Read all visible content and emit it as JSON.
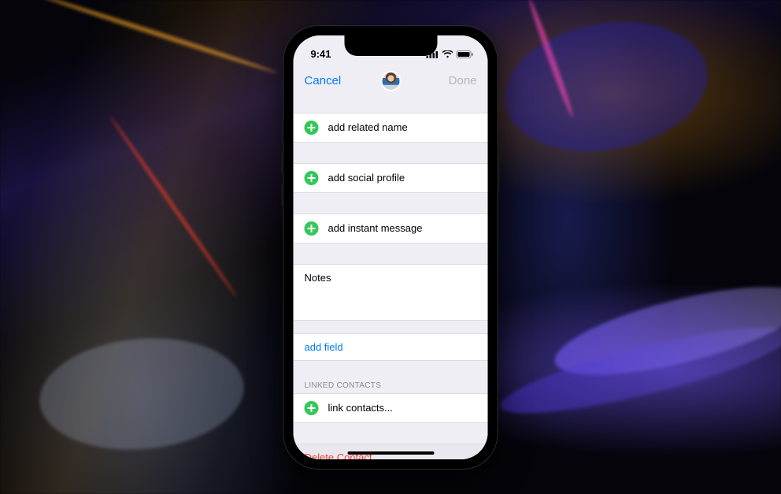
{
  "status": {
    "time": "9:41"
  },
  "nav": {
    "cancel": "Cancel",
    "done": "Done"
  },
  "rows": {
    "related": "add related name",
    "social": "add social profile",
    "im": "add instant message",
    "notes": "Notes",
    "addfield": "add field",
    "link": "link contacts...",
    "delete": "Delete Contact"
  },
  "sections": {
    "linked": "LINKED CONTACTS"
  }
}
